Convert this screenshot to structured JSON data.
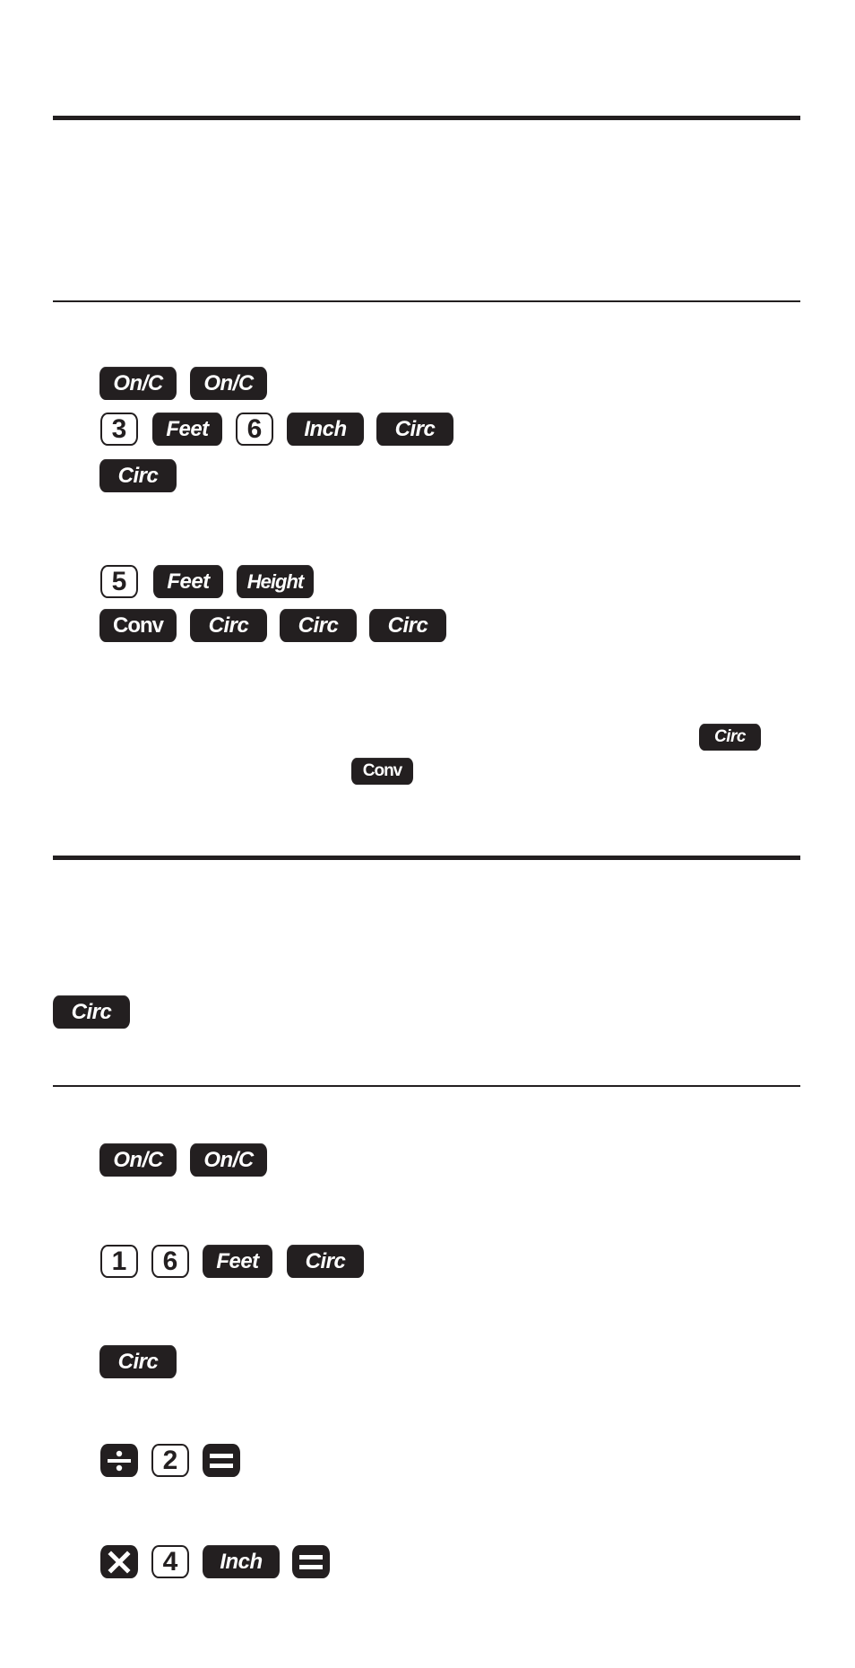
{
  "colors": {
    "ink": "#231f20",
    "paper": "#ffffff"
  },
  "sections": [
    {
      "id": "example-1",
      "rows": [
        {
          "keys": [
            {
              "type": "fn",
              "label": "On/C"
            },
            {
              "type": "fn",
              "label": "On/C"
            }
          ]
        },
        {
          "keys": [
            {
              "type": "num",
              "label": "3"
            },
            {
              "type": "fn",
              "label": "Feet"
            },
            {
              "type": "num",
              "label": "6"
            },
            {
              "type": "fn",
              "label": "Inch"
            },
            {
              "type": "fn",
              "label": "Circ"
            }
          ]
        },
        {
          "keys": [
            {
              "type": "fn",
              "label": "Circ"
            }
          ]
        },
        {
          "keys": [
            {
              "type": "num",
              "label": "5"
            },
            {
              "type": "fn",
              "label": "Feet"
            },
            {
              "type": "fn",
              "label": "Height"
            }
          ]
        },
        {
          "keys": [
            {
              "type": "fn",
              "label": "Conv"
            },
            {
              "type": "fn",
              "label": "Circ"
            },
            {
              "type": "fn",
              "label": "Circ"
            },
            {
              "type": "fn",
              "label": "Circ"
            }
          ]
        }
      ],
      "note_keys": [
        {
          "type": "fn",
          "label": "Circ"
        },
        {
          "type": "fn",
          "label": "Conv"
        }
      ]
    },
    {
      "id": "intro-2",
      "keys": [
        {
          "type": "fn",
          "label": "Circ"
        }
      ]
    },
    {
      "id": "example-2",
      "rows": [
        {
          "keys": [
            {
              "type": "fn",
              "label": "On/C"
            },
            {
              "type": "fn",
              "label": "On/C"
            }
          ]
        },
        {
          "keys": [
            {
              "type": "num",
              "label": "1"
            },
            {
              "type": "num",
              "label": "6"
            },
            {
              "type": "fn",
              "label": "Feet"
            },
            {
              "type": "fn",
              "label": "Circ"
            }
          ]
        },
        {
          "keys": [
            {
              "type": "fn",
              "label": "Circ"
            }
          ]
        },
        {
          "keys": [
            {
              "type": "op",
              "label": "÷",
              "icon": "divide-icon"
            },
            {
              "type": "num",
              "label": "2"
            },
            {
              "type": "op",
              "label": "=",
              "icon": "equals-icon"
            }
          ]
        },
        {
          "keys": [
            {
              "type": "op",
              "label": "×",
              "icon": "multiply-icon"
            },
            {
              "type": "num",
              "label": "4"
            },
            {
              "type": "fn",
              "label": "Inch"
            },
            {
              "type": "op",
              "label": "=",
              "icon": "equals-icon"
            }
          ]
        }
      ]
    }
  ]
}
